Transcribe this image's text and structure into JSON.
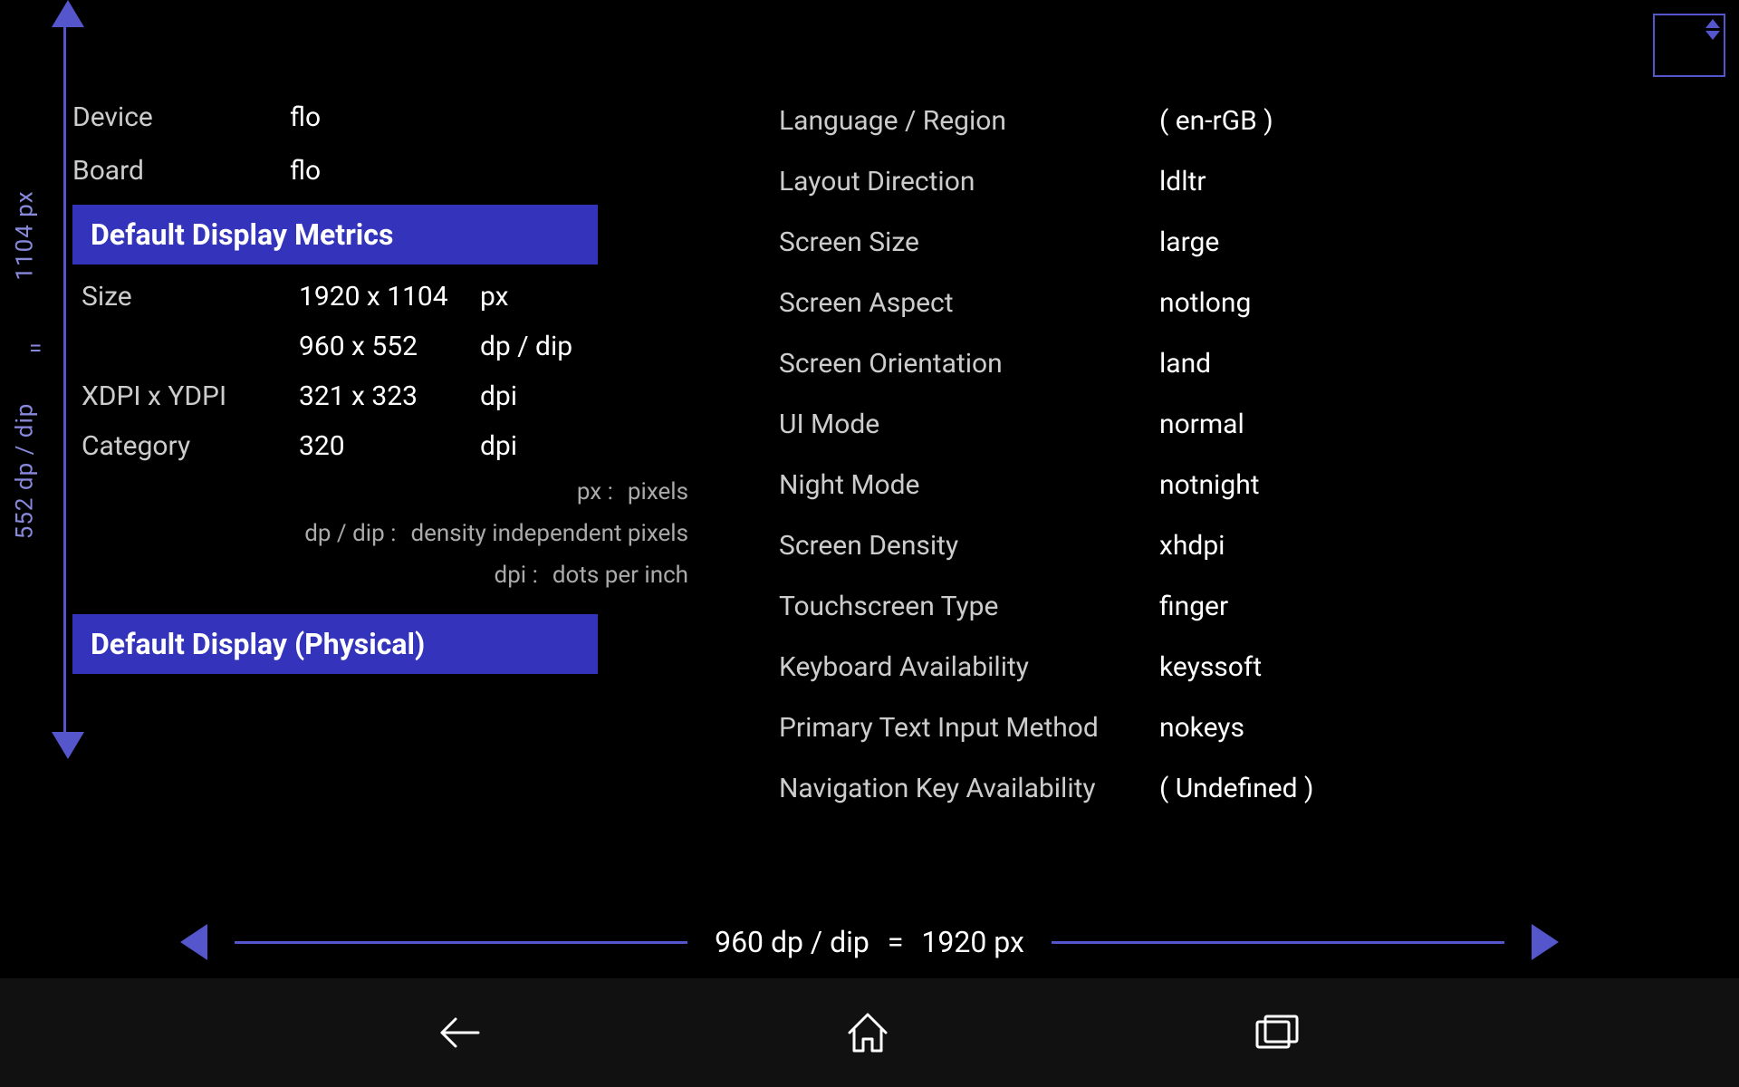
{
  "device": {
    "label": "Device",
    "value": "flo"
  },
  "board": {
    "label": "Board",
    "value": "flo"
  },
  "defaultDisplayMetrics": {
    "header": "Default Display Metrics",
    "size": {
      "label": "Size",
      "px_value": "1920 x 1104",
      "px_unit": "px",
      "dp_value": "960 x 552",
      "dp_unit": "dp / dip"
    },
    "xdpi": {
      "label": "XDPI x YDPI",
      "value": "321 x 323",
      "unit": "dpi"
    },
    "category": {
      "label": "Category",
      "value": "320",
      "unit": "dpi"
    }
  },
  "legend": {
    "px": {
      "key": "px :",
      "value": "pixels"
    },
    "dp": {
      "key": "dp / dip :",
      "value": "density independent pixels"
    },
    "dpi": {
      "key": "dpi :",
      "value": "dots per inch"
    }
  },
  "defaultDisplayPhysical": {
    "header": "Default Display (Physical)"
  },
  "right": {
    "rows": [
      {
        "label": "Language / Region",
        "value": "( en-rGB )"
      },
      {
        "label": "Layout Direction",
        "value": "ldltr"
      },
      {
        "label": "Screen Size",
        "value": "large"
      },
      {
        "label": "Screen Aspect",
        "value": "notlong"
      },
      {
        "label": "Screen Orientation",
        "value": "land"
      },
      {
        "label": "UI Mode",
        "value": "normal"
      },
      {
        "label": "Night Mode",
        "value": "notnight"
      },
      {
        "label": "Screen Density",
        "value": "xhdpi"
      },
      {
        "label": "Touchscreen Type",
        "value": "finger"
      },
      {
        "label": "Keyboard Availability",
        "value": "keyssoft"
      },
      {
        "label": "Primary Text Input Method",
        "value": "nokeys"
      },
      {
        "label": "Navigation Key Availability",
        "value": "( Undefined )"
      }
    ]
  },
  "bottomBar": {
    "dp_value": "960 dp / dip",
    "equals": "=",
    "px_value": "1920 px"
  },
  "verticalLabel": {
    "top": "1104 px",
    "equals": "=",
    "bottom": "552 dp / dip"
  },
  "nav": {
    "back": "←",
    "home": "⌂",
    "recents": "▭"
  }
}
